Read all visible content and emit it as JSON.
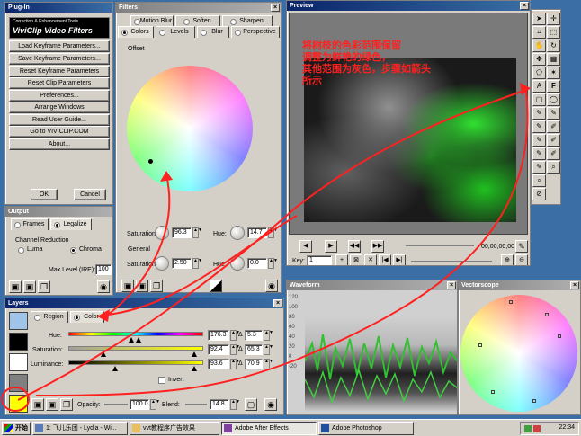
{
  "plugin": {
    "title": "Plug-In",
    "logo_line1": "Correction & Enhancement Tools",
    "logo_line2": "ViviClip Video Filters",
    "buttons": [
      "Load Keyframe Parameters...",
      "Save Keyframe Parameters...",
      "Reset Keyframe Parameters",
      "Reset Clip Parameters",
      "Preferences...",
      "Arrange Windows",
      "Read User Guide...",
      "Go to VIVICLIP.COM",
      "About..."
    ],
    "ok": "OK",
    "cancel": "Cancel"
  },
  "filters": {
    "title": "Filters",
    "tabs_row1": [
      "Motion Blur",
      "Soften",
      "Sharpen"
    ],
    "tabs_row2": [
      "Colors",
      "Levels",
      "Blur",
      "Perspective"
    ],
    "offset_label": "Offset",
    "saturation_label": "Saturation:",
    "saturation_value": "96.3",
    "hue_label": "Hue:",
    "hue_value": "14.7",
    "general_label": "General",
    "gen_saturation_label": "Saturation:",
    "gen_saturation_value": "2.50",
    "gen_hue_label": "Hue:",
    "gen_hue_value": "0.0"
  },
  "output": {
    "title": "Output",
    "tabs": [
      "Frames",
      "Legalize"
    ],
    "channel_reduction": "Channel Reduction",
    "luma": "Luma",
    "chroma": "Chroma",
    "max_level_label": "Max Level (IRE):",
    "max_level_value": "100"
  },
  "layers": {
    "title": "Layers",
    "region": "Region",
    "color": "Color",
    "hue_label": "Hue:",
    "hue_value": "176.3",
    "hue_delta": "5.3",
    "saturation_label": "Saturation:",
    "saturation_value": "92.4",
    "saturation_delta": "65.3",
    "luminance_label": "Luminance:",
    "luminance_value": "93.6",
    "luminance_delta": "70.9",
    "invert": "Invert",
    "opacity_label": "Opacity:",
    "opacity_value": "100.0",
    "blend_label": "Blend:",
    "blend_value": "14.8"
  },
  "preview": {
    "title": "Preview",
    "annotation": "将树枝的色彩范围保留\n调整为鲜艳的绿色，\n其他范围为灰色，步骤如箭头\n所示",
    "timecode": "00;00;00;00",
    "key_label": "Key:",
    "key_value": "1"
  },
  "waveform": {
    "title": "Waveform",
    "scale": [
      "120",
      "100",
      "80",
      "60",
      "40",
      "20",
      "0",
      "-20"
    ]
  },
  "vectorscope": {
    "title": "Vectorscope"
  },
  "taskbar": {
    "start": "开始",
    "tasks": [
      "1: 飞儿乐团 - Lydia - Wi...",
      "vvt教程序广告效果",
      "Adobe After Effects",
      "Adobe Photoshop"
    ],
    "clock": "22:34"
  },
  "colors": {
    "titlebar": "#0a246a",
    "panel": "#d4d0c8",
    "annotation": "#ff2020",
    "selected_swatch": "#ffff00"
  }
}
